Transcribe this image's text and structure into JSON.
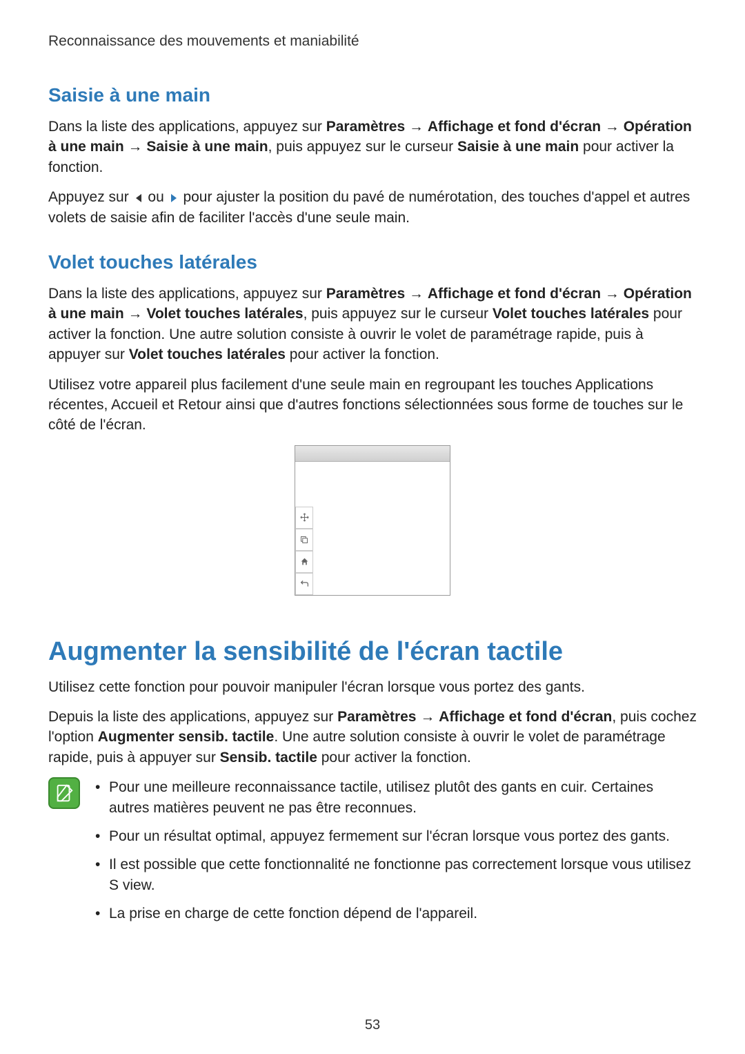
{
  "header": "Reconnaissance des mouvements et maniabilité",
  "s1": {
    "title": "Saisie à une main",
    "p1a": "Dans la liste des applications, appuyez sur ",
    "p1b": "Paramètres",
    "arrow": " → ",
    "p1c": "Affichage et fond d'écran",
    "p1d": "Opération à une main",
    "p1e": "Saisie à une main",
    "p1f": ", puis appuyez sur le curseur ",
    "p1g": "Saisie à une main",
    "p1h": " pour activer la fonction.",
    "p2a": "Appuyez sur ",
    "p2b": " ou ",
    "p2c": " pour ajuster la position du pavé de numérotation, des touches d'appel et autres volets de saisie afin de faciliter l'accès d'une seule main."
  },
  "s2": {
    "title": "Volet touches latérales",
    "p1a": "Dans la liste des applications, appuyez sur ",
    "p1b": "Paramètres",
    "p1c": "Affichage et fond d'écran",
    "p1d": "Opération à une main",
    "p1e": "Volet touches latérales",
    "p1f": ", puis appuyez sur le curseur ",
    "p1g": "Volet touches latérales",
    "p1h": " pour activer la fonction. Une autre solution consiste à ouvrir le volet de paramétrage rapide, puis à appuyer sur ",
    "p1i": "Volet touches latérales",
    "p1j": " pour activer la fonction.",
    "p2": "Utilisez votre appareil plus facilement d'une seule main en regroupant les touches Applications récentes, Accueil et Retour ainsi que d'autres fonctions sélectionnées sous forme de touches sur le côté de l'écran."
  },
  "s3": {
    "title": "Augmenter la sensibilité de l'écran tactile",
    "p1": "Utilisez cette fonction pour pouvoir manipuler l'écran lorsque vous portez des gants.",
    "p2a": "Depuis la liste des applications, appuyez sur ",
    "p2b": "Paramètres",
    "p2c": "Affichage et fond d'écran",
    "p2d": ", puis cochez l'option ",
    "p2e": "Augmenter sensib. tactile",
    "p2f": ". Une autre solution consiste à ouvrir le volet de paramétrage rapide, puis à appuyer sur ",
    "p2g": "Sensib. tactile",
    "p2h": " pour activer la fonction.",
    "bullets": [
      "Pour une meilleure reconnaissance tactile, utilisez plutôt des gants en cuir. Certaines autres matières peuvent ne pas être reconnues.",
      "Pour un résultat optimal, appuyez fermement sur l'écran lorsque vous portez des gants.",
      "Il est possible que cette fonctionnalité ne fonctionne pas correctement lorsque vous utilisez S view.",
      "La prise en charge de cette fonction dépend de l'appareil."
    ]
  },
  "page": "53"
}
